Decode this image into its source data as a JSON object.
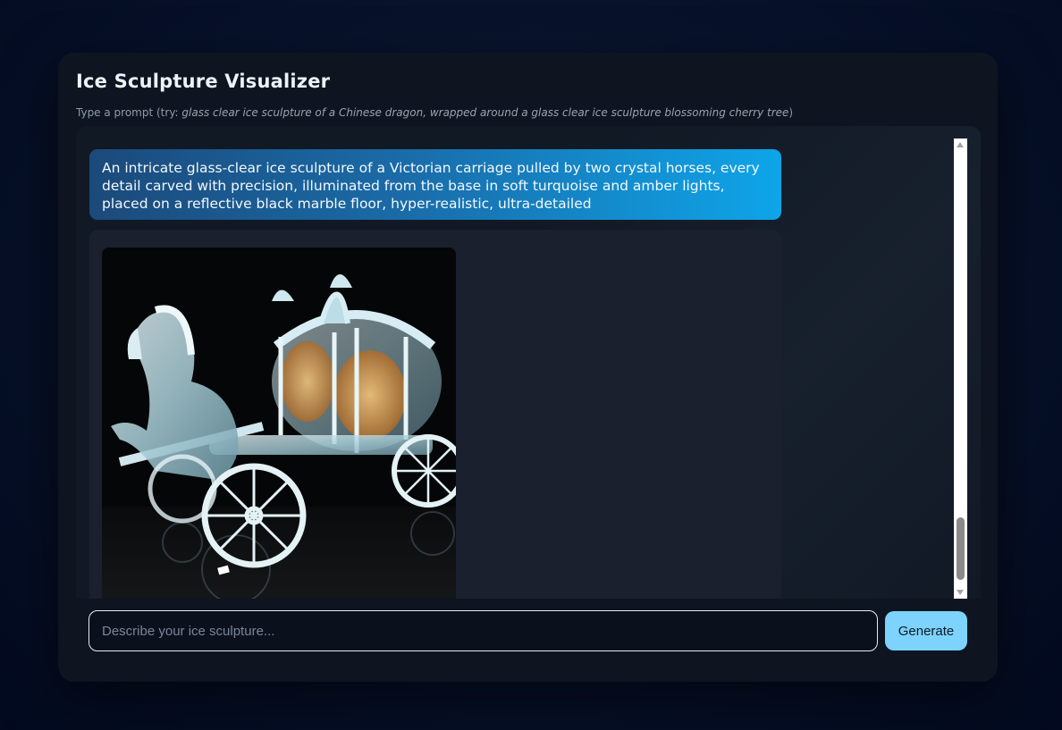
{
  "app": {
    "title": "Ice Sculpture Visualizer",
    "hint_prefix": "Type a prompt (try: ",
    "hint_example": "glass clear ice sculpture of a Chinese dragon, wrapped around a glass clear ice sculpture blossoming cherry tree",
    "hint_suffix": ")"
  },
  "chat": {
    "user_prompt": "An intricate glass-clear ice sculpture of a Victorian carriage pulled by two crystal horses, every detail carved with precision, illuminated from the base in soft turquoise and amber lights, placed on a reflective black marble floor, hyper-realistic, ultra-detailed"
  },
  "composer": {
    "placeholder": "Describe your ice sculpture...",
    "value": "",
    "submit_label": "Generate"
  },
  "colors": {
    "accent": "#7dd3fc",
    "bubble_start": "#1b4a7a",
    "bubble_end": "#0ea5e9",
    "panel": "#0e1520"
  }
}
